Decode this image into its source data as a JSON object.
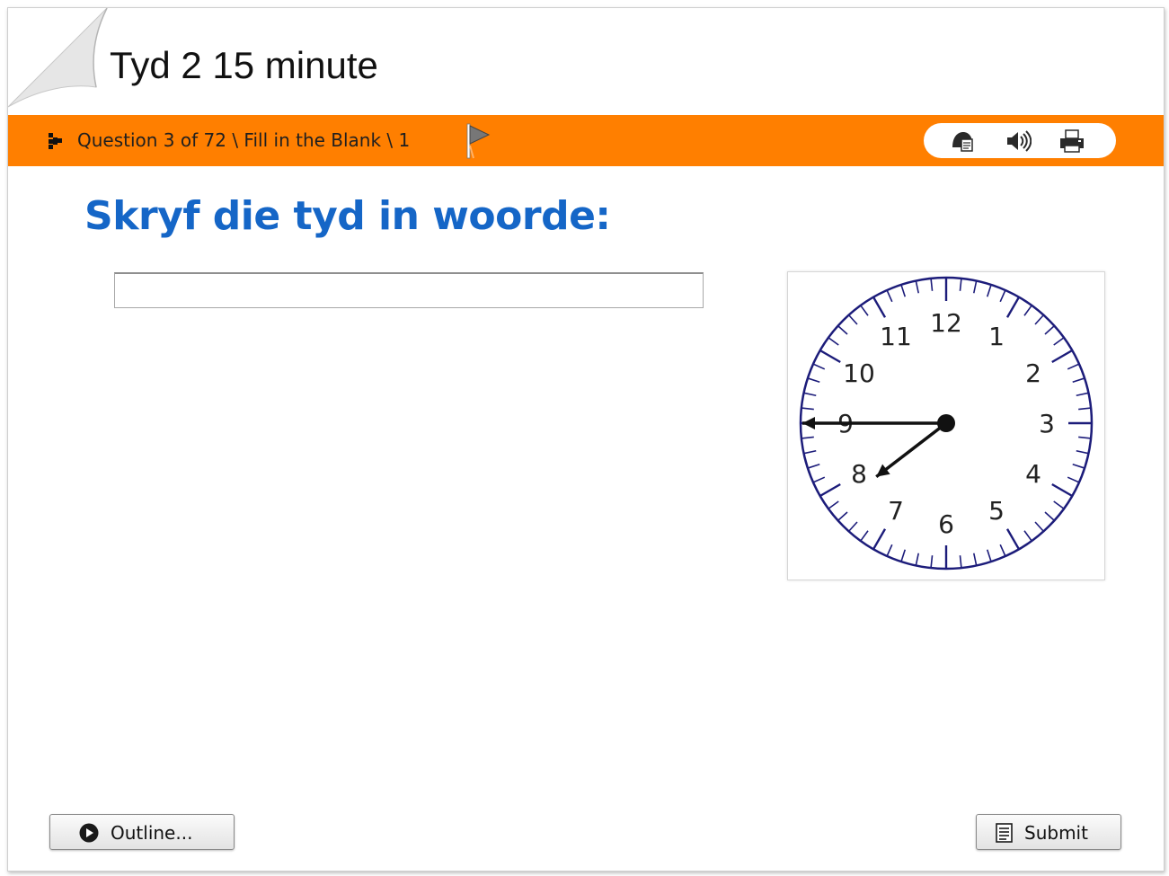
{
  "header": {
    "title": "Tyd 2 15 minute"
  },
  "question_bar": {
    "question_text": "Question 3 of 72 \\ Fill in the Blank \\ 1",
    "icons": [
      "nav-arrow-icon",
      "flag-icon",
      "glossary-icon",
      "audio-icon",
      "print-icon"
    ],
    "bar_color": "#ff7f00"
  },
  "question": {
    "prompt": "Skryf die tyd in woorde:",
    "prompt_color": "#1566c7",
    "answer_value": "",
    "answer_placeholder": ""
  },
  "clock": {
    "numerals": [
      "12",
      "1",
      "2",
      "3",
      "4",
      "5",
      "6",
      "7",
      "8",
      "9",
      "10",
      "11"
    ],
    "hour": 7,
    "minute": 45,
    "tick_color": "#1c1c7a"
  },
  "footer": {
    "outline_label": "Outline...",
    "submit_label": "Submit"
  }
}
